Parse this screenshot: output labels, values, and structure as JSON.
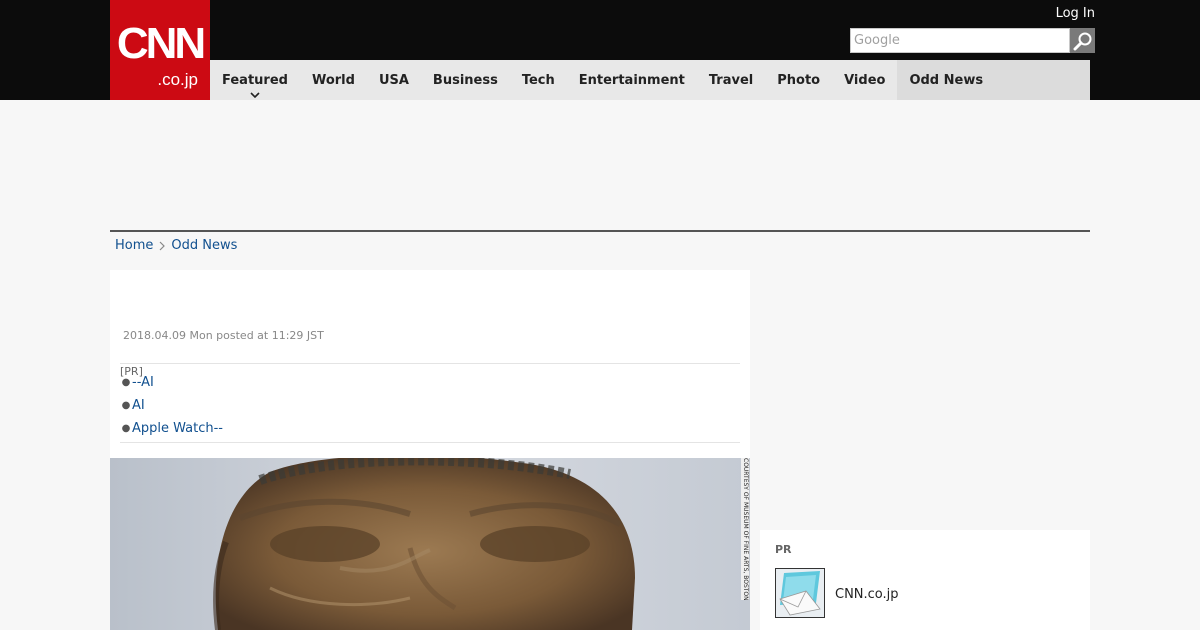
{
  "header": {
    "logo_main": "CNN",
    "logo_sub": ".co.jp",
    "login_label": "Log In",
    "search_placeholder": "Google"
  },
  "nav": {
    "items": [
      {
        "label": "Featured"
      },
      {
        "label": "World"
      },
      {
        "label": "USA"
      },
      {
        "label": "Business"
      },
      {
        "label": "Tech"
      },
      {
        "label": "Entertainment"
      },
      {
        "label": "Travel"
      },
      {
        "label": "Photo"
      },
      {
        "label": "Video"
      },
      {
        "label": "Odd News"
      }
    ],
    "active": "Odd News"
  },
  "breadcrumb": {
    "home": "Home",
    "current": "Odd News"
  },
  "article": {
    "posted": "2018.04.09 Mon posted at 11:29 JST",
    "pr_label": "[PR]",
    "pr_links": [
      "--AI",
      "AI",
      "Apple Watch--"
    ],
    "photo_credit": "COURTESY OF MUSEUM OF FINE ARTS, BOSTON"
  },
  "sidebar": {
    "pr_label": "PR",
    "pr_item_name": "CNN.co.jp"
  },
  "colors": {
    "brand_red": "#cc0a13",
    "header_bg": "#0c0c0c",
    "link_blue": "#11508f"
  }
}
